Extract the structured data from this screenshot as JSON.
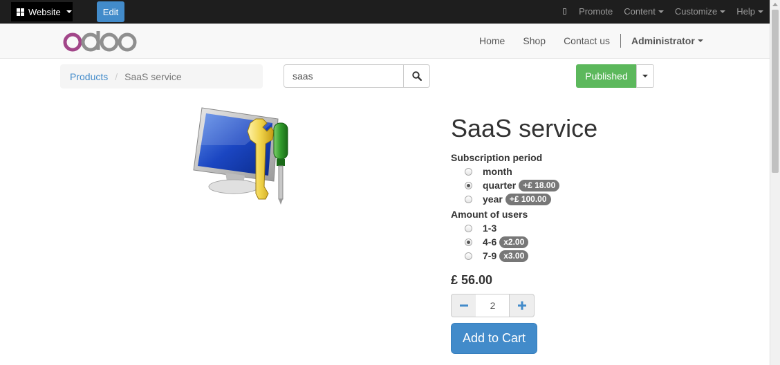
{
  "topbar": {
    "website_label": "Website",
    "edit_label": "Edit",
    "menu": [
      {
        "label": "Promote",
        "has_icon": true
      },
      {
        "label": "Content",
        "dropdown": true
      },
      {
        "label": "Customize",
        "dropdown": true
      },
      {
        "label": "Help",
        "dropdown": true
      }
    ]
  },
  "navbar": {
    "logo_text": "odoo",
    "links": [
      "Home",
      "Shop",
      "Contact us"
    ],
    "user": "Administrator"
  },
  "breadcrumb": {
    "parent": "Products",
    "current": "SaaS service"
  },
  "search": {
    "value": "saas"
  },
  "publish": {
    "label": "Published"
  },
  "product": {
    "name": "SaaS service",
    "attributes": [
      {
        "title": "Subscription period",
        "options": [
          {
            "label": "month",
            "badge": "",
            "checked": false
          },
          {
            "label": "quarter",
            "badge": "+£ 18.00",
            "checked": true
          },
          {
            "label": "year",
            "badge": "+£ 100.00",
            "checked": false
          }
        ]
      },
      {
        "title": "Amount of users",
        "options": [
          {
            "label": "1-3",
            "badge": "",
            "checked": false
          },
          {
            "label": "4-6",
            "badge": "x2.00",
            "checked": true
          },
          {
            "label": "7-9",
            "badge": "x3.00",
            "checked": false
          }
        ]
      }
    ],
    "price": "£ 56.00",
    "quantity": "2",
    "add_to_cart": "Add to Cart"
  },
  "colors": {
    "primary": "#428bca",
    "success": "#5cb85c",
    "logo_purple": "#a24689",
    "logo_gray": "#8f8f8f"
  }
}
